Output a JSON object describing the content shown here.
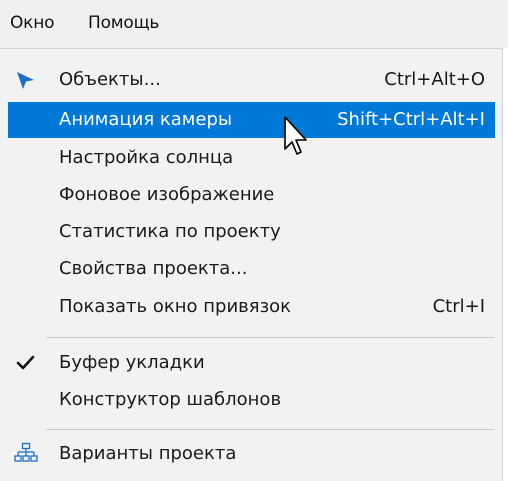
{
  "menubar": {
    "items": [
      {
        "label": "Окно"
      },
      {
        "label": "Помощь"
      }
    ]
  },
  "menu": {
    "items": [
      {
        "label": "Объекты...",
        "shortcut": "Ctrl+Alt+O",
        "icon": "pointer-arrow-icon"
      },
      {
        "label": "Анимация камеры",
        "shortcut": "Shift+Ctrl+Alt+I",
        "highlighted": true
      },
      {
        "label": "Настройка солнца"
      },
      {
        "label": "Фоновое изображение"
      },
      {
        "label": "Статистика по проекту"
      },
      {
        "label": "Свойства проекта..."
      },
      {
        "label": "Показать окно привязок",
        "shortcut": "Ctrl+I"
      },
      {
        "label": "Буфер укладки",
        "checked": true,
        "icon": "checkmark-icon"
      },
      {
        "label": "Конструктор шаблонов"
      },
      {
        "label": "Варианты проекта",
        "icon": "project-variants-icon"
      }
    ]
  },
  "colors": {
    "highlight": "#0078d7",
    "menu_background": "#f2f2f2",
    "menubar_background": "#f0f0f0",
    "pointer_icon": "#1f6fc2"
  }
}
